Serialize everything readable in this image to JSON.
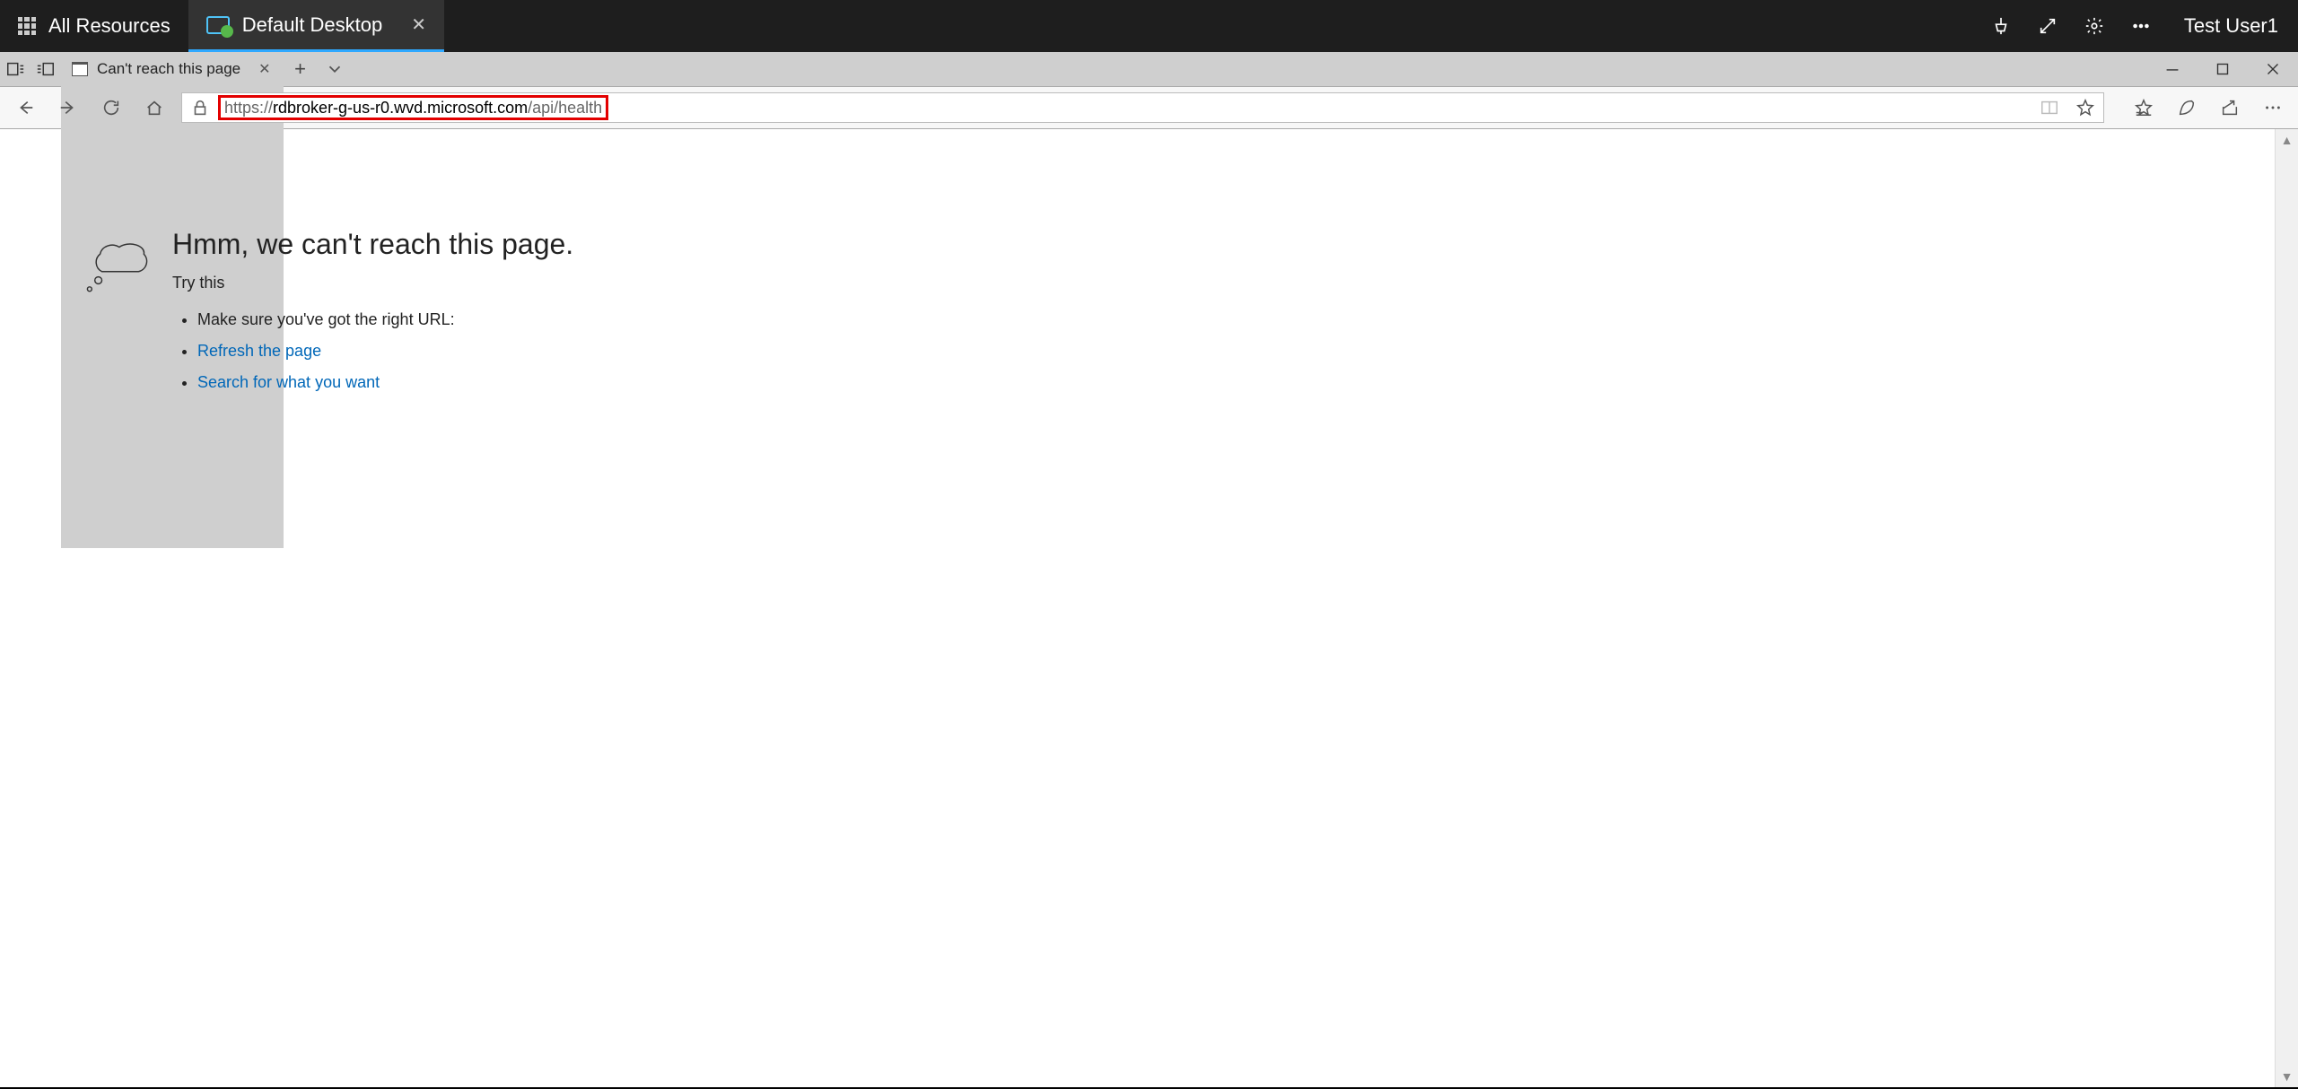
{
  "rd": {
    "all_tab": "All Resources",
    "desk_tab": "Default Desktop",
    "user": "Test User1"
  },
  "browser": {
    "tab_title": "Can't reach this page",
    "url_proto_prefix": "https://",
    "url_host": "rdbroker-g-us-r0.wvd.microsoft.com",
    "url_path": "/api/health"
  },
  "err": {
    "heading": "Hmm, we can't reach this page.",
    "try": "Try this",
    "sugg1": "Make sure you've got the right URL:",
    "sugg2": "Refresh the page",
    "sugg3": "Search for what you want"
  }
}
